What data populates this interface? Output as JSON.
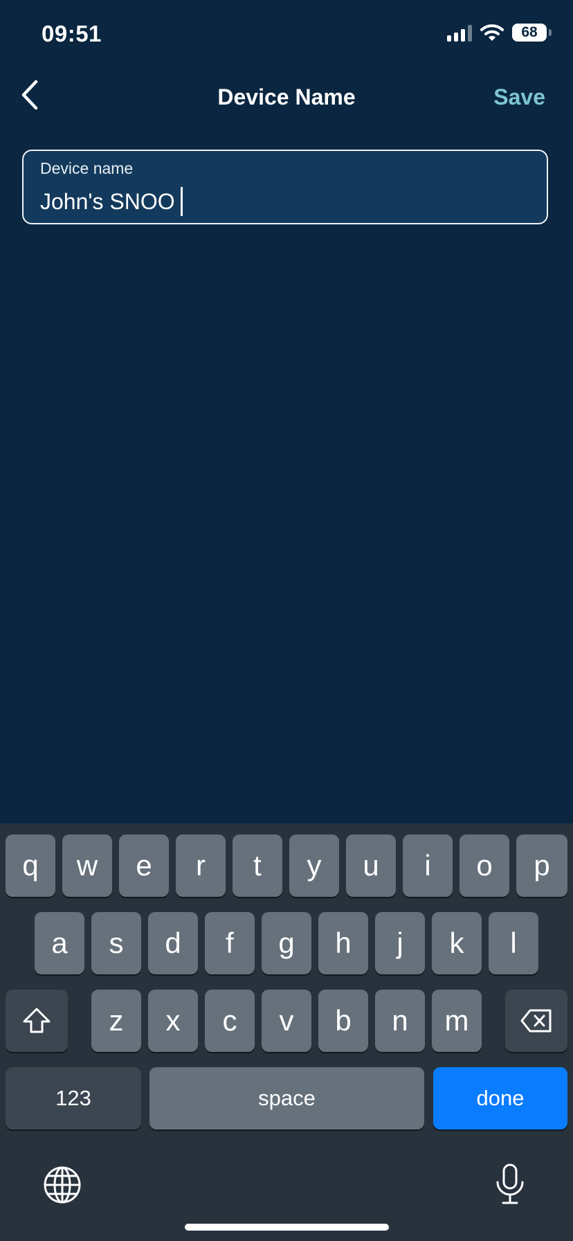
{
  "status_bar": {
    "time": "09:51",
    "battery": "68"
  },
  "nav": {
    "title": "Device Name",
    "save_label": "Save"
  },
  "field": {
    "label": "Device name",
    "value": "John's SNOO"
  },
  "keyboard": {
    "row1": [
      "q",
      "w",
      "e",
      "r",
      "t",
      "y",
      "u",
      "i",
      "o",
      "p"
    ],
    "row2": [
      "a",
      "s",
      "d",
      "f",
      "g",
      "h",
      "j",
      "k",
      "l"
    ],
    "row3": [
      "z",
      "x",
      "c",
      "v",
      "b",
      "n",
      "m"
    ],
    "numbers_label": "123",
    "space_label": "space",
    "done_label": "done"
  },
  "colors": {
    "background": "#0a2640",
    "accent": "#7ec6cf",
    "done": "#0a7cff"
  },
  "icons": [
    "back-chevron-icon",
    "signal-icon",
    "wifi-icon",
    "battery-icon",
    "shift-icon",
    "backspace-icon",
    "globe-icon",
    "microphone-icon"
  ]
}
